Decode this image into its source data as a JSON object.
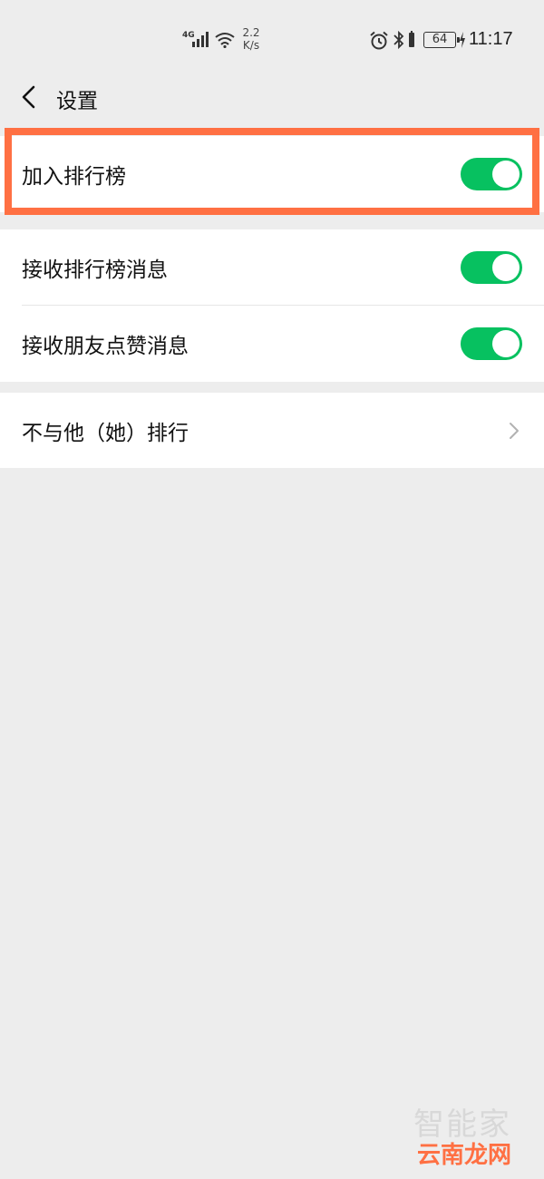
{
  "status_bar": {
    "network": "4G",
    "speed_value": "2.2",
    "speed_unit": "K/s",
    "battery": "64",
    "time": "11:17"
  },
  "nav": {
    "title": "设置"
  },
  "settings": {
    "join_leaderboard": {
      "label": "加入排行榜",
      "enabled": true
    },
    "receive_leaderboard_msg": {
      "label": "接收排行榜消息",
      "enabled": true
    },
    "receive_like_msg": {
      "label": "接收朋友点赞消息",
      "enabled": true
    },
    "exclude": {
      "label": "不与他（她）排行"
    }
  },
  "watermark": {
    "top": "智能家",
    "bottom": "云南龙网"
  },
  "colors": {
    "toggle_on": "#07c160",
    "highlight": "#ff7043",
    "background": "#ededed"
  }
}
